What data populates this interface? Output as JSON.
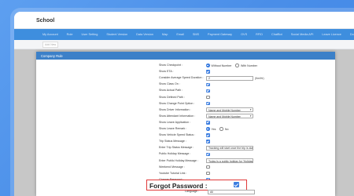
{
  "app": {
    "title": "School"
  },
  "menu": [
    "My Account",
    "Role",
    "User Setting",
    "Student Version",
    "Data Version",
    "Map",
    "Email",
    "SMS",
    "Payment Gateway",
    "OVS",
    "RFID",
    "ChatBot",
    "Social Media API",
    "Leave Licence",
    "Document",
    "Archive"
  ],
  "toolbar": {
    "button_label": "Add New"
  },
  "modal": {
    "title": "Company Rule",
    "rows": [
      {
        "label": "Show Checkpoint :",
        "type": "radio",
        "options": [
          "Without Number",
          "With Number"
        ],
        "selected": 0
      },
      {
        "label": "Show ETA :",
        "type": "checkbox",
        "checked": true
      },
      {
        "label": "Consider Average Speed Duration :",
        "type": "text-unit",
        "value": "2",
        "unit": "(Km/Hr)"
      },
      {
        "label": "Show Class On :",
        "type": "checkbox",
        "checked": true
      },
      {
        "label": "Show Actual Path :",
        "type": "checkbox",
        "checked": true
      },
      {
        "label": "Show Defined Path :",
        "type": "checkbox",
        "checked": false
      },
      {
        "label": "Show Change Point Option :",
        "type": "checkbox",
        "checked": true
      },
      {
        "label": "Show Driver Information :",
        "type": "select",
        "value": "Name and Mobile Number"
      },
      {
        "label": "Show Attendant Information :",
        "type": "select",
        "value": "Name and Mobile Number"
      },
      {
        "label": "Show Leave Application :",
        "type": "checkbox",
        "checked": true
      },
      {
        "label": "Show Leave Remark :",
        "type": "radio",
        "options": [
          "Yes",
          "No"
        ],
        "selected": 0
      },
      {
        "label": "Show Vehicle Speed Status :",
        "type": "checkbox",
        "checked": true
      },
      {
        "label": "Trip Status Message :",
        "type": "checkbox",
        "checked": true
      },
      {
        "label": "Enter Trip Status Message :",
        "type": "text",
        "value": "Tracking will start once the trip is sta"
      },
      {
        "label": "Public Holiday Message :",
        "type": "checkbox",
        "checked": true
      },
      {
        "label": "Enter Public Holiday Message :",
        "type": "text",
        "value": "Today is a public holiday for 'Holiday"
      },
      {
        "label": "Weekend Message :",
        "type": "checkbox",
        "checked": false
      },
      {
        "label": "Youtube Tutorial Link :",
        "type": "checkbox",
        "checked": false
      },
      {
        "label": "Change Password :",
        "type": "checkbox",
        "checked": true
      }
    ],
    "highlight": {
      "label": "Forgot Password :",
      "checked": true
    },
    "language": {
      "label": "Language :",
      "value": "All"
    }
  }
}
